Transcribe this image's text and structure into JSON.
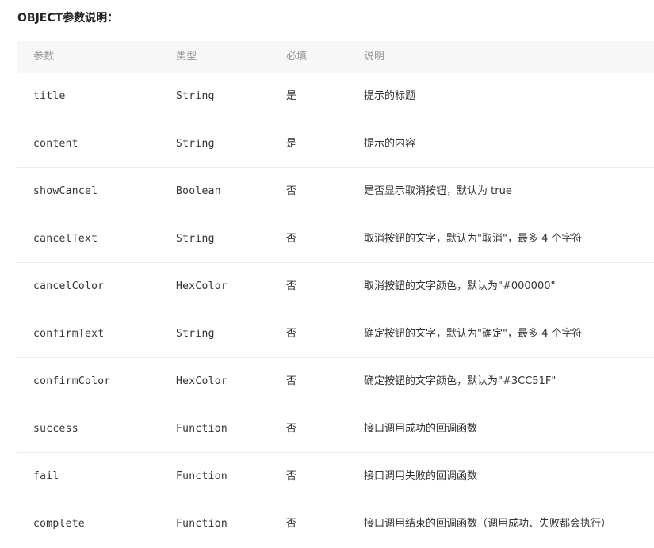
{
  "heading": "OBJECT参数说明：",
  "table": {
    "headers": [
      "参数",
      "类型",
      "必填",
      "说明"
    ],
    "rows": [
      {
        "param": "title",
        "type": "String",
        "required": "是",
        "desc": "提示的标题"
      },
      {
        "param": "content",
        "type": "String",
        "required": "是",
        "desc": "提示的内容"
      },
      {
        "param": "showCancel",
        "type": "Boolean",
        "required": "否",
        "desc": "是否显示取消按钮，默认为 true"
      },
      {
        "param": "cancelText",
        "type": "String",
        "required": "否",
        "desc": "取消按钮的文字，默认为\"取消\"，最多 4 个字符"
      },
      {
        "param": "cancelColor",
        "type": "HexColor",
        "required": "否",
        "desc": "取消按钮的文字颜色，默认为\"#000000\""
      },
      {
        "param": "confirmText",
        "type": "String",
        "required": "否",
        "desc": "确定按钮的文字，默认为\"确定\"，最多 4 个字符"
      },
      {
        "param": "confirmColor",
        "type": "HexColor",
        "required": "否",
        "desc": "确定按钮的文字颜色，默认为\"#3CC51F\""
      },
      {
        "param": "success",
        "type": "Function",
        "required": "否",
        "desc": "接口调用成功的回调函数"
      },
      {
        "param": "fail",
        "type": "Function",
        "required": "否",
        "desc": "接口调用失败的回调函数"
      },
      {
        "param": "complete",
        "type": "Function",
        "required": "否",
        "desc": "接口调用结束的回调函数（调用成功、失败都会执行）"
      }
    ]
  }
}
